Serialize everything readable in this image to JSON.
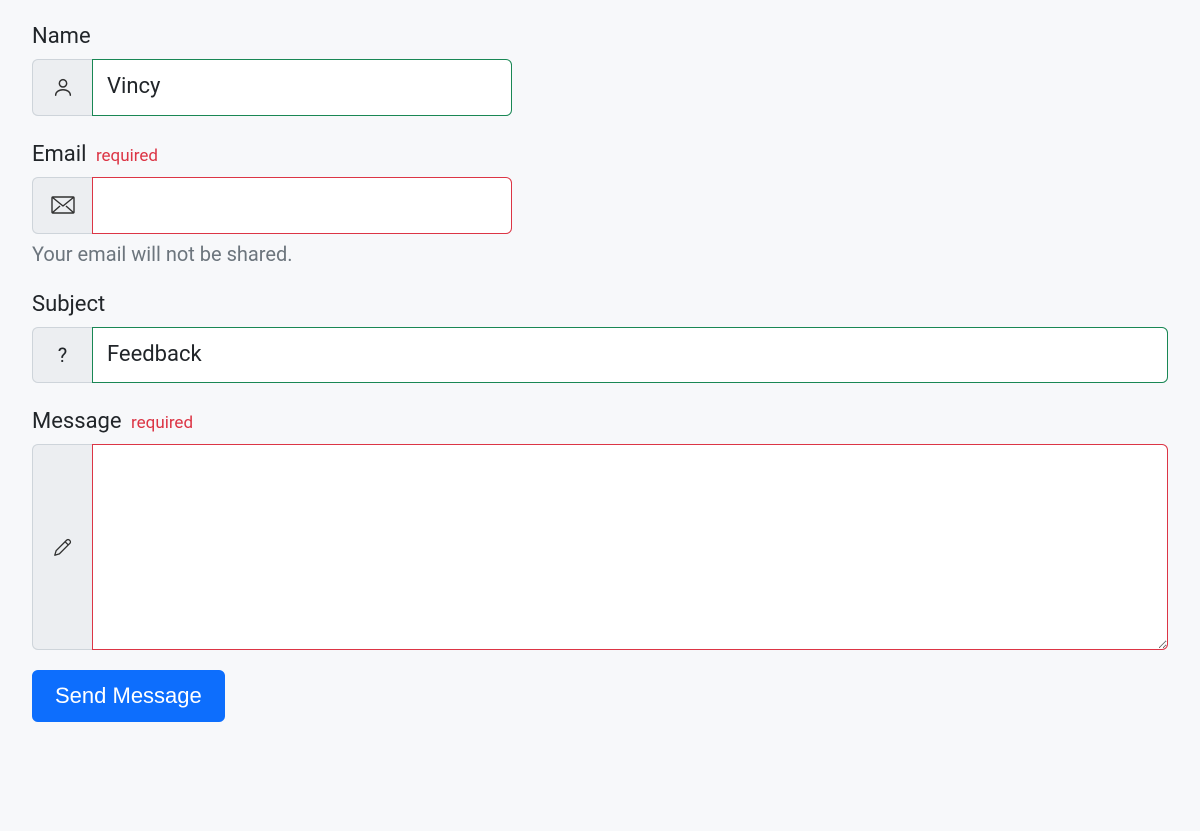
{
  "form": {
    "required_tag": "required",
    "name": {
      "label": "Name",
      "value": "Vincy",
      "state": "valid"
    },
    "email": {
      "label": "Email",
      "value": "",
      "state": "invalid",
      "help_text": "Your email will not be shared."
    },
    "subject": {
      "label": "Subject",
      "value": "Feedback",
      "state": "valid"
    },
    "message": {
      "label": "Message",
      "value": "",
      "state": "invalid"
    },
    "submit_label": "Send Message"
  },
  "icons": {
    "question_mark": "?"
  }
}
